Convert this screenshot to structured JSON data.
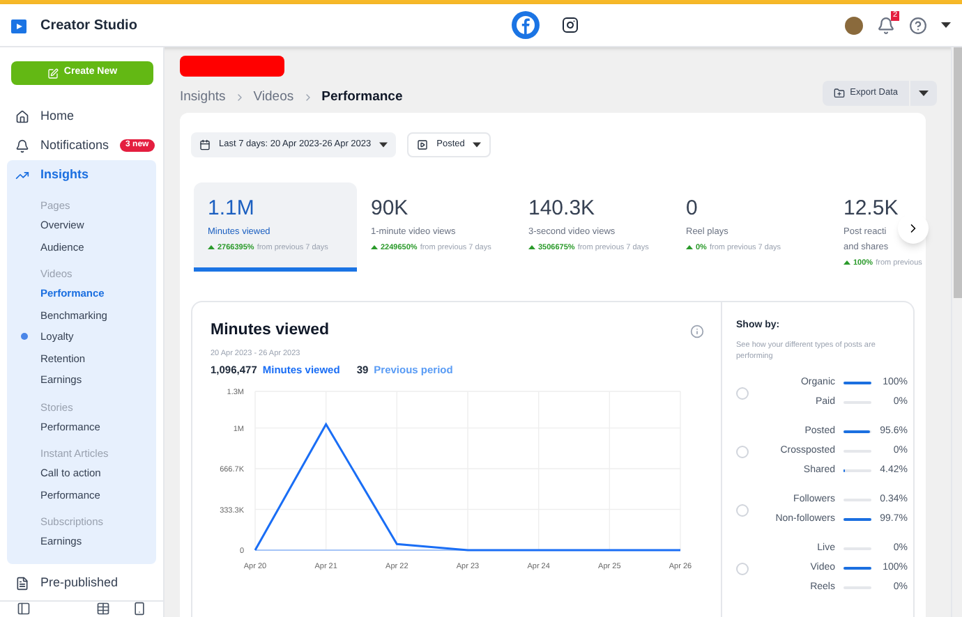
{
  "header": {
    "title": "Creator Studio",
    "notification_count": "2"
  },
  "sidebar": {
    "create_button": "Create New",
    "items": [
      {
        "label": "Home",
        "selected": false
      },
      {
        "label": "Notifications",
        "badge": "3 new",
        "selected": false
      },
      {
        "label": "Insights",
        "selected": true,
        "sections": [
          {
            "heading": "Pages",
            "items": [
              {
                "label": "Overview",
                "selected": false
              },
              {
                "label": "Audience",
                "selected": false
              }
            ]
          },
          {
            "heading": "Videos",
            "items": [
              {
                "label": "Performance",
                "selected": true
              },
              {
                "label": "Benchmarking",
                "selected": false
              },
              {
                "label": "Loyalty",
                "selected": false
              },
              {
                "label": "Retention",
                "selected": false
              },
              {
                "label": "Earnings",
                "selected": false
              }
            ]
          },
          {
            "heading": "Stories",
            "items": [
              {
                "label": "Performance",
                "selected": false
              }
            ]
          },
          {
            "heading": "Instant Articles",
            "items": [
              {
                "label": "Call to action",
                "selected": false
              },
              {
                "label": "Performance",
                "selected": false
              }
            ]
          },
          {
            "heading": "Subscriptions",
            "items": [
              {
                "label": "Earnings",
                "selected": false
              }
            ]
          }
        ]
      }
    ],
    "bottom_item": "Pre-published"
  },
  "breadcrumb": [
    "Insights",
    "Videos",
    "Performance"
  ],
  "export_button": "Export Data",
  "filters": {
    "date_range": "Last 7 days: 20 Apr 2023-26 Apr 2023",
    "post_type": "Posted"
  },
  "metrics": [
    {
      "value": "1.1M",
      "label": "Minutes viewed",
      "change": "2766395%",
      "suffix": "from previous 7 days",
      "selected": true
    },
    {
      "value": "90K",
      "label": "1-minute video views",
      "change": "2249650%",
      "suffix": "from previous 7 days",
      "selected": false
    },
    {
      "value": "140.3K",
      "label": "3-second video views",
      "change": "3506675%",
      "suffix": "from previous 7 days",
      "selected": false
    },
    {
      "value": "0",
      "label": "Reel plays",
      "change": "0%",
      "suffix": "from previous 7 days",
      "selected": false
    },
    {
      "value": "12.5K",
      "label": "Post reacti",
      "label_line_2": "and shares",
      "change": "100%",
      "suffix": "from previous",
      "selected": false
    }
  ],
  "chart_panel": {
    "title": "Minutes viewed",
    "date_range": "20 Apr 2023 - 26 Apr 2023",
    "total": "1,096,477",
    "previous": "39",
    "previous_label": "Previous period",
    "chart_data": {
      "type": "line",
      "categories": [
        "Apr 20",
        "Apr 21",
        "Apr 22",
        "Apr 23",
        "Apr 24",
        "Apr 25",
        "Apr 26"
      ],
      "series": [
        {
          "name": "Minutes viewed",
          "color": "#1a6ef5",
          "values": [
            0,
            1030000,
            50000,
            0,
            0,
            0,
            0
          ]
        }
      ],
      "grid": true,
      "ylim": [
        0,
        1300000
      ],
      "yticks": [
        {
          "value": 0,
          "label": "0"
        },
        {
          "value": 333300,
          "label": "333.3K"
        },
        {
          "value": 666700,
          "label": "666.7K"
        },
        {
          "value": 1000000,
          "label": "1M"
        },
        {
          "value": 1300000,
          "label": "1.3M"
        }
      ]
    }
  },
  "show_by": {
    "title": "Show by:",
    "description": "See how your different types of posts are performing",
    "groups": [
      {
        "selected": false,
        "rows": [
          {
            "label": "Organic",
            "level": 1,
            "reading": "100%"
          },
          {
            "label": "Paid",
            "level": 0,
            "reading": "0%"
          }
        ]
      },
      {
        "selected": false,
        "rows": [
          {
            "label": "Posted",
            "level": 0.956,
            "reading": "95.6%"
          },
          {
            "label": "Crossposted",
            "level": 0,
            "reading": "0%"
          },
          {
            "label": "Shared",
            "level": 0.0442,
            "reading": "4.42%"
          }
        ]
      },
      {
        "selected": false,
        "rows": [
          {
            "label": "Followers",
            "level": 0.0034,
            "reading": "0.34%"
          },
          {
            "label": "Non-followers",
            "level": 0.997,
            "reading": "99.7%"
          }
        ]
      },
      {
        "selected": false,
        "rows": [
          {
            "label": "Live",
            "level": 0,
            "reading": "0%"
          },
          {
            "label": "Video",
            "level": 1,
            "reading": "100%"
          },
          {
            "label": "Reels",
            "level": 0,
            "reading": "0%"
          }
        ]
      }
    ]
  }
}
